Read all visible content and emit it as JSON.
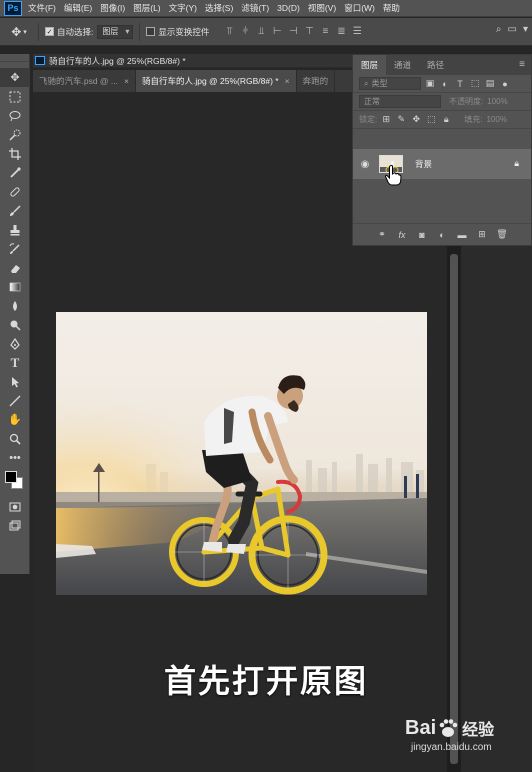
{
  "app": {
    "logo": "Ps"
  },
  "menu": [
    "文件(F)",
    "编辑(E)",
    "图像(I)",
    "图层(L)",
    "文字(Y)",
    "选择(S)",
    "滤镜(T)",
    "3D(D)",
    "视图(V)",
    "窗口(W)",
    "帮助"
  ],
  "options": {
    "auto_select_label": "自动选择:",
    "auto_select_checked": true,
    "auto_select_target": "图层",
    "show_transform_label": "显示变换控件",
    "show_transform_checked": false
  },
  "document": {
    "title": "骑自行车的人.jpg @ 25%(RGB/8#) *",
    "tabs": [
      {
        "label": "飞驰的汽车.psd @ ...",
        "active": false
      },
      {
        "label": "骑自行车的人.jpg @ 25%(RGB/8#) *",
        "active": true
      },
      {
        "label": "奔跑的",
        "active": false
      }
    ]
  },
  "layers_panel": {
    "tabs": [
      {
        "label": "图层",
        "active": true
      },
      {
        "label": "通道",
        "active": false
      },
      {
        "label": "路径",
        "active": false
      }
    ],
    "filter_placeholder": "类型",
    "blend_mode": "正常",
    "opacity_label": "不透明度:",
    "opacity_value": "100%",
    "lock_label": "锁定:",
    "fill_label": "填充:",
    "fill_value": "100%",
    "layers": [
      {
        "name": "背景",
        "visible": true,
        "locked": true
      }
    ]
  },
  "caption": "首先打开原图",
  "watermark": {
    "brand": "Bai",
    "brand_suffix": "经验",
    "url": "jingyan.baidu.com"
  },
  "colors": {
    "ui_dark": "#535353",
    "canvas_bg": "#282828",
    "ps_blue": "#3ba3ff",
    "bike_yellow": "#e8c82a",
    "handlebar_red": "#d8393a"
  }
}
